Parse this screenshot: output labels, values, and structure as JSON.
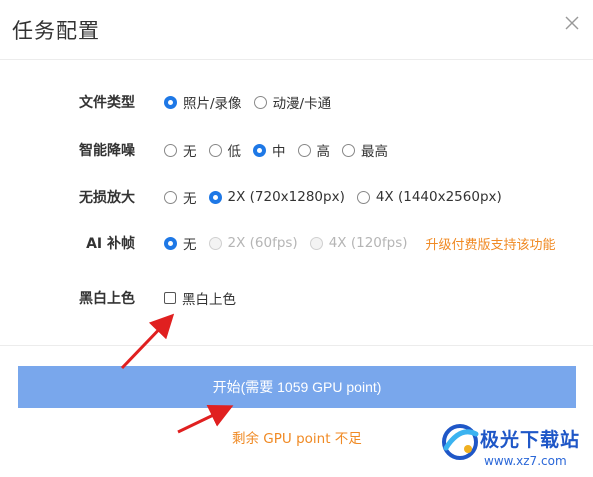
{
  "dialog": {
    "title": "任务配置",
    "close_icon": "close-icon"
  },
  "settings": [
    {
      "key": "file-type",
      "label": "文件类型",
      "options": [
        {
          "label": "照片/录像",
          "checked": true,
          "disabled": false
        },
        {
          "label": "动漫/卡通",
          "checked": false,
          "disabled": false
        }
      ]
    },
    {
      "key": "denoise",
      "label": "智能降噪",
      "options": [
        {
          "label": "无",
          "checked": false,
          "disabled": false
        },
        {
          "label": "低",
          "checked": false,
          "disabled": false
        },
        {
          "label": "中",
          "checked": true,
          "disabled": false
        },
        {
          "label": "高",
          "checked": false,
          "disabled": false
        },
        {
          "label": "最高",
          "checked": false,
          "disabled": false
        }
      ]
    },
    {
      "key": "upscale",
      "label": "无损放大",
      "options": [
        {
          "label": "无",
          "checked": false,
          "disabled": false
        },
        {
          "label": "2X (720x1280px)",
          "checked": true,
          "disabled": false
        },
        {
          "label": "4X (1440x2560px)",
          "checked": false,
          "disabled": false
        }
      ]
    },
    {
      "key": "frame-interp",
      "label": "AI 补帧",
      "options": [
        {
          "label": "无",
          "checked": true,
          "disabled": false
        },
        {
          "label": "2X (60fps)",
          "checked": false,
          "disabled": true
        },
        {
          "label": "4X (120fps)",
          "checked": false,
          "disabled": true
        }
      ],
      "upgrade_note": "升级付费版支持该功能"
    }
  ],
  "colorize": {
    "label": "黑白上色",
    "checkbox_label": "黑白上色",
    "checked": false
  },
  "start_button": {
    "label": "开始(需要 1059 GPU point)"
  },
  "warning": "剩余 GPU point 不足",
  "watermark": {
    "name": "极光下载站",
    "url": "www.xz7.com"
  },
  "colors": {
    "accent": "#1e78e6",
    "button": "#79a7ec",
    "warning": "#f08a24",
    "arrow": "#e02020"
  }
}
